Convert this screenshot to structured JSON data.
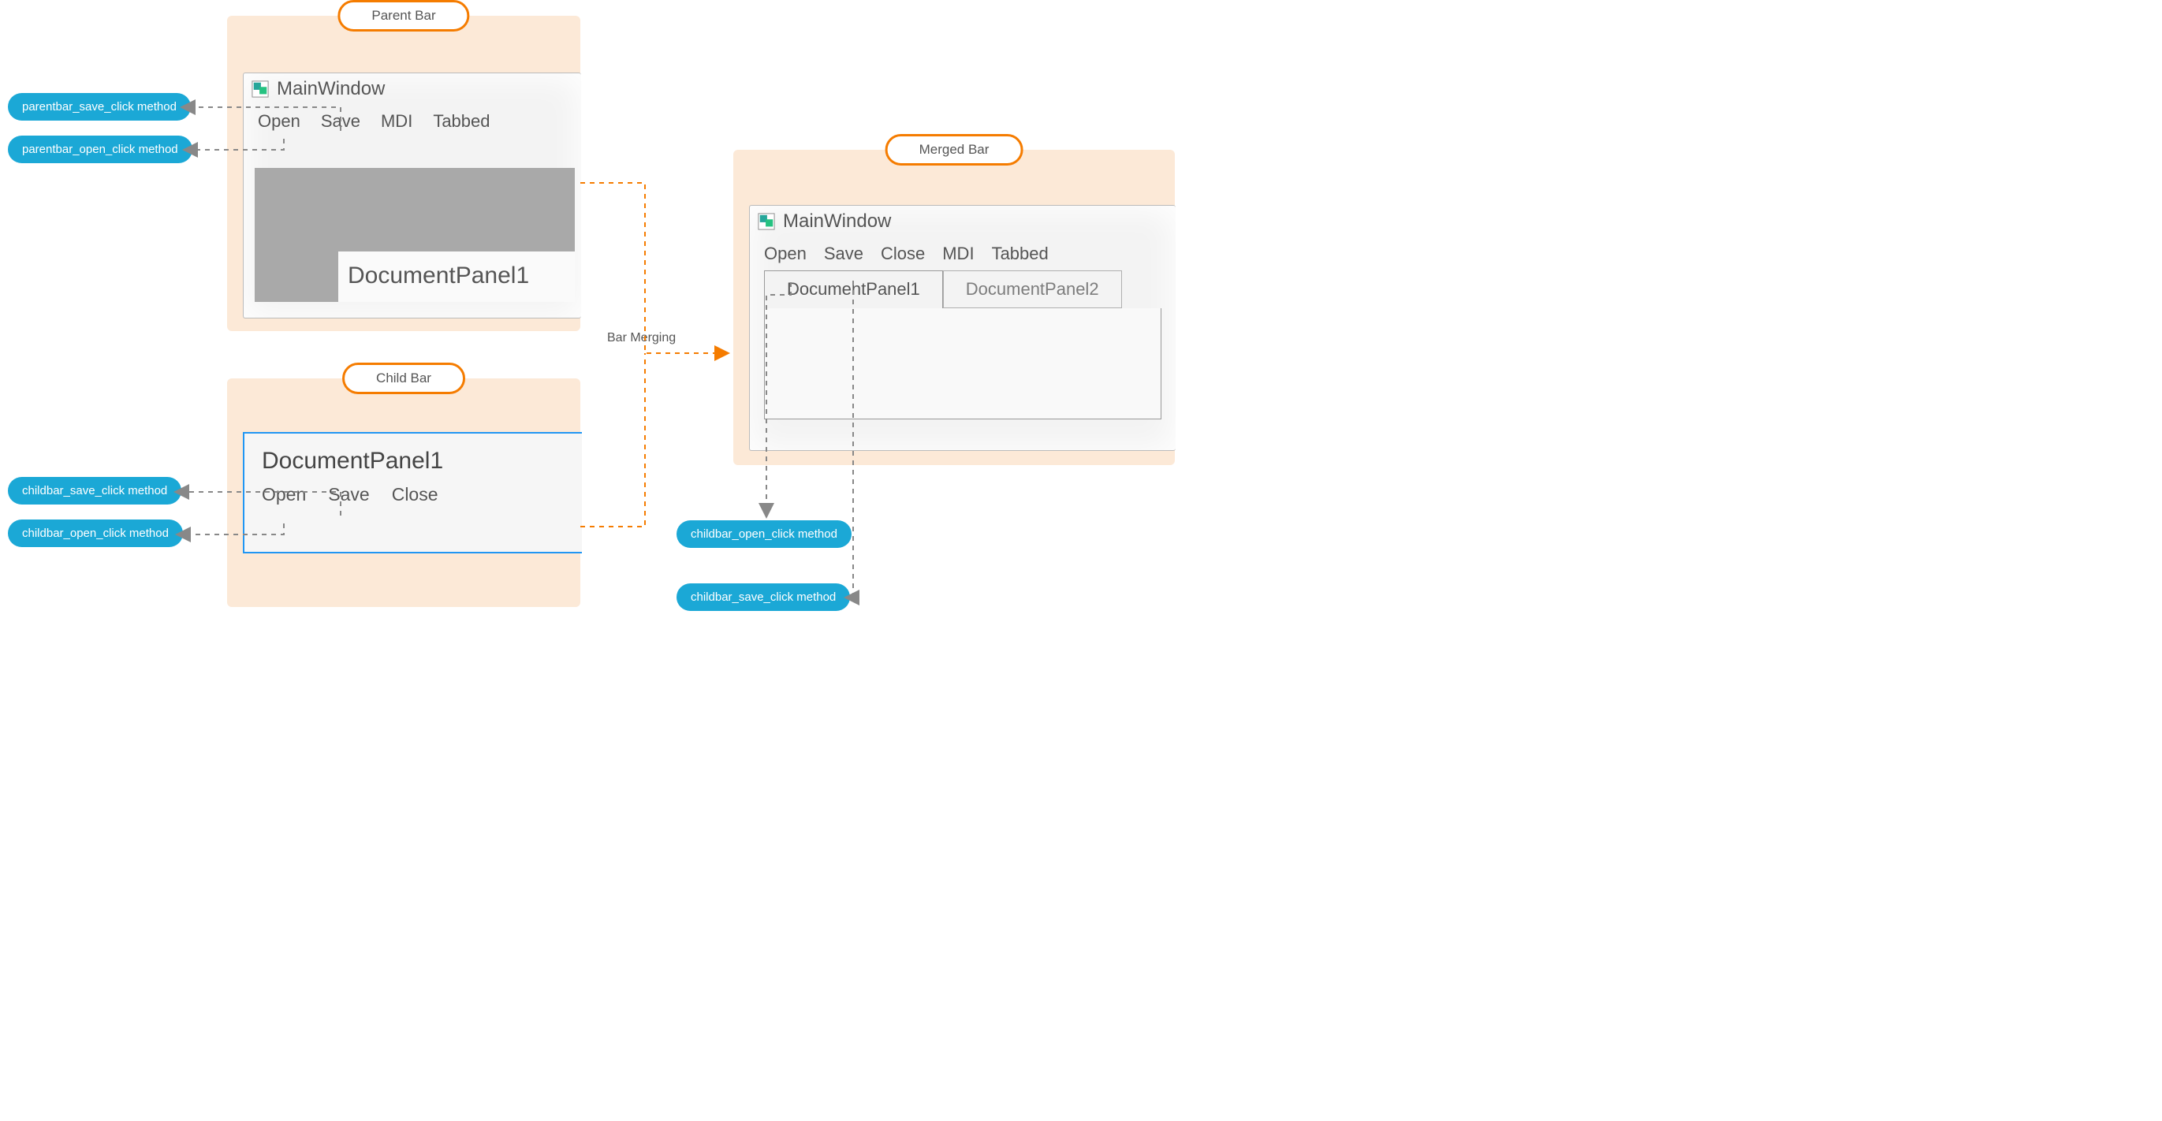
{
  "cards": {
    "parent": {
      "title": "Parent Bar"
    },
    "child": {
      "title": "Child Bar"
    },
    "merged": {
      "title": "Merged Bar"
    }
  },
  "pills": {
    "parent_save": "parentbar_save_click method",
    "parent_open": "parentbar_open_click method",
    "child_save": "childbar_save_click method",
    "child_open": "childbar_open_click method",
    "merged_open": "childbar_open_click method",
    "merged_save": "childbar_save_click method"
  },
  "parentWindow": {
    "title": "MainWindow",
    "menu": [
      "Open",
      "Save",
      "MDI",
      "Tabbed"
    ],
    "documentLabel": "DocumentPanel1"
  },
  "childWindow": {
    "title": "DocumentPanel1",
    "menu": [
      "Open",
      "Save",
      "Close"
    ]
  },
  "mergedWindow": {
    "title": "MainWindow",
    "menu": [
      "Open",
      "Save",
      "Close",
      "MDI",
      "Tabbed"
    ],
    "tabs": [
      "DocumentPanel1",
      "DocumentPanel2"
    ]
  },
  "connectorLabel": "Bar Merging",
  "colors": {
    "peach": "#fce9d7",
    "orangeBorder": "#f57c00",
    "pillBlue": "#1ba8d6",
    "docBorder": "#2196f3",
    "dash": "#888888",
    "orangeDash": "#f57c00"
  }
}
